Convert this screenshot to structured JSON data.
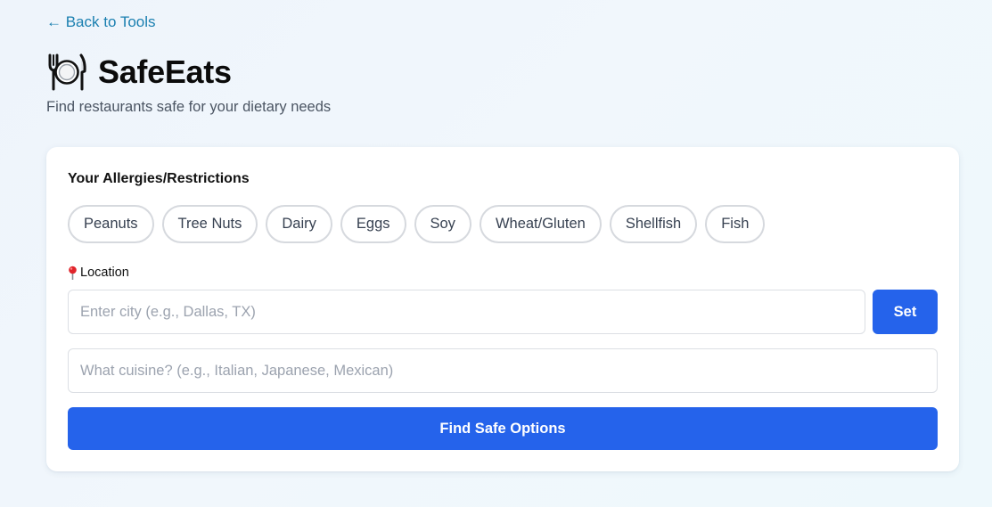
{
  "nav": {
    "back_label": "← Back to Tools"
  },
  "header": {
    "logo_icon": "fork-knife-plate-icon",
    "title": "SafeEats",
    "subtitle": "Find restaurants safe for your dietary needs"
  },
  "restrictions": {
    "label": "Your Allergies/Restrictions",
    "options": [
      "Peanuts",
      "Tree Nuts",
      "Dairy",
      "Eggs",
      "Soy",
      "Wheat/Gluten",
      "Shellfish",
      "Fish"
    ]
  },
  "location": {
    "icon": "pin-icon",
    "label": "Location",
    "value": "",
    "placeholder": "Enter city (e.g., Dallas, TX)",
    "set_label": "Set"
  },
  "cuisine": {
    "value": "",
    "placeholder": "What cuisine? (e.g., Italian, Japanese, Mexican)"
  },
  "actions": {
    "find_label": "Find Safe Options"
  },
  "colors": {
    "accent": "#2563eb",
    "link": "#1a7fb0",
    "chip_border": "#d6d9de"
  }
}
